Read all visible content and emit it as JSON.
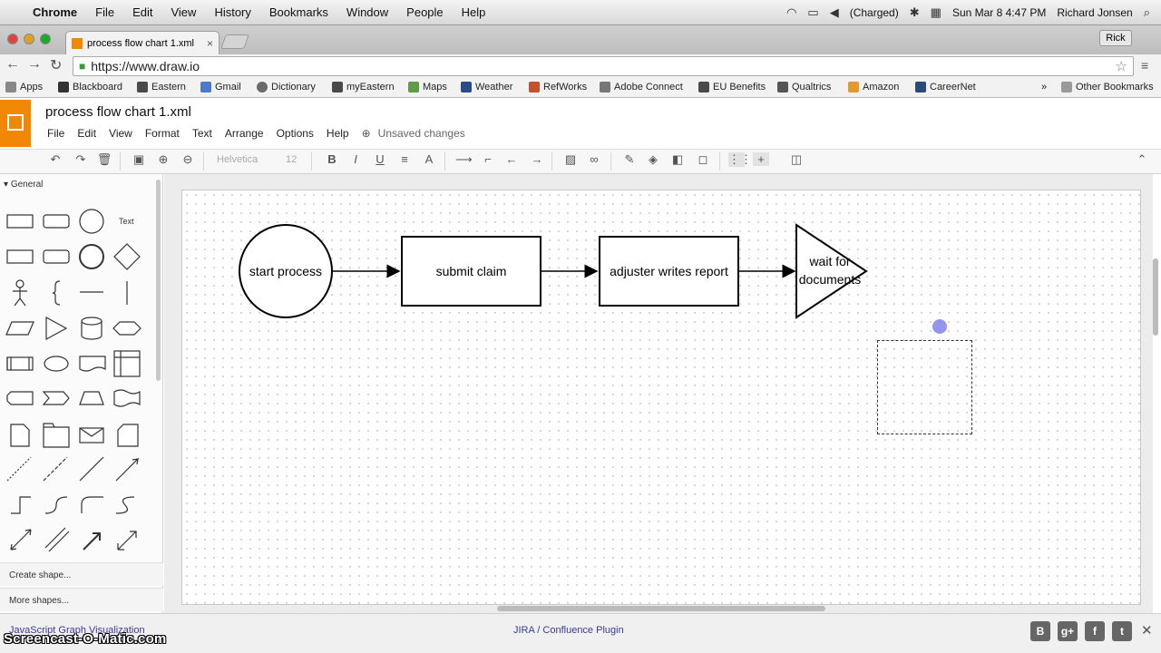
{
  "mac_menubar": {
    "apple_icon": "apple-icon",
    "app_name": "Chrome",
    "items": [
      "File",
      "Edit",
      "View",
      "History",
      "Bookmarks",
      "Window",
      "People",
      "Help"
    ],
    "battery_text": "(Charged)",
    "clock": "Sun Mar 8  4:47 PM",
    "user": "Richard Jonsen"
  },
  "browser": {
    "tab_title": "process flow chart 1.xml",
    "profile_button": "Rick",
    "url": "https://www.draw.io"
  },
  "bookmarks": {
    "items": [
      "Apps",
      "Blackboard",
      "Eastern",
      "Gmail",
      "Dictionary",
      "myEastern",
      "Maps",
      "Weather",
      "RefWorks",
      "Adobe Connect",
      "EU Benefits",
      "Qualtrics",
      "Amazon",
      "CareerNet"
    ],
    "overflow": "»",
    "other": "Other Bookmarks"
  },
  "app": {
    "doc_title": "process flow chart 1.xml",
    "menu": [
      "File",
      "Edit",
      "View",
      "Format",
      "Text",
      "Arrange",
      "Options",
      "Help"
    ],
    "status": "Unsaved changes",
    "font_name": "Helvetica",
    "font_size": "12"
  },
  "sidebar": {
    "section_title": "General",
    "text_shape_label": "Text",
    "create_shape": "Create shape...",
    "more_shapes": "More shapes..."
  },
  "diagram": {
    "nodes": [
      "start process",
      "submit claim",
      "adjuster writes report",
      "wait for documents"
    ]
  },
  "footer": {
    "left_link": "JavaScript Graph Visualization",
    "center_link": "JIRA / Confluence Plugin",
    "watermark": "Screencast-O-Matic.com"
  },
  "colors": {
    "drawio_orange": "#f08705",
    "link_blue": "#3a3a9a",
    "cursor_highlight": "#7a7ae8"
  }
}
